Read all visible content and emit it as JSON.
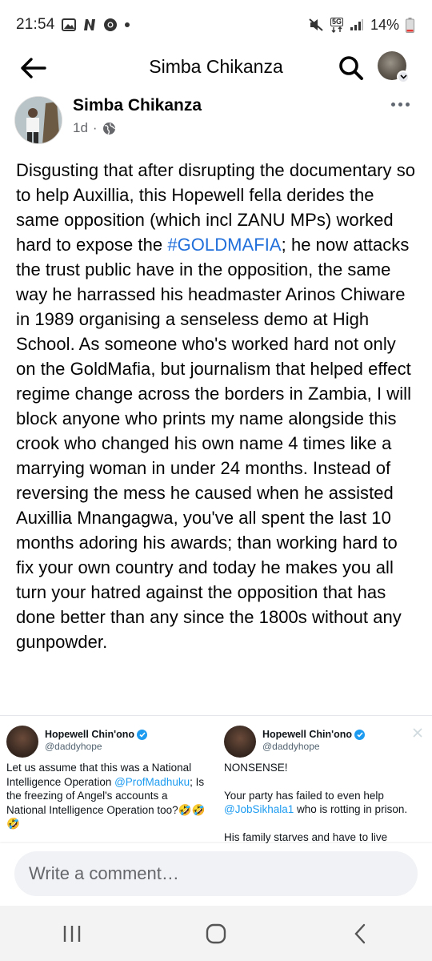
{
  "status_bar": {
    "time": "21:54",
    "network": "5G",
    "battery": "14%"
  },
  "header": {
    "title": "Simba Chikanza"
  },
  "post": {
    "author": "Simba Chikanza",
    "age": "1d",
    "body_before_hashtag": "Disgusting that after disrupting the documentary so to help Auxillia, this Hopewell fella derides the same opposition (which incl ZANU MPs) worked hard to expose the ",
    "hashtag": "#GOLDMAFIA",
    "body_after_hashtag": "; he now attacks the trust public have in the opposition, the same way he harrassed his headmaster Arinos Chiware in 1989 organising a senseless demo at High School. As someone who's worked hard not only on the GoldMafia, but journalism that helped effect regime change across the borders in Zambia, I will block anyone who prints my name alongside this crook who changed his own name 4 times like a marrying woman in under 24 months. Instead of reversing the mess he caused when he assisted Auxillia Mnangagwa, you've all spent the last 10 months adoring his awards; than working hard to fix your own country  and today he makes you all turn your hatred against the opposition that has done better than any since the 1800s without any gunpowder."
  },
  "tweets": [
    {
      "name": "Hopewell Chin'ono",
      "handle": "@daddyhope",
      "text_1": "Let us assume that this was a National Intelligence Operation ",
      "mention_1": "@ProfMadhuku",
      "text_2": "; Is the freezing of Angel's accounts a National Intelligence Operation too?🤣🤣🤣"
    },
    {
      "name": "Hopewell Chin'ono",
      "handle": "@daddyhope",
      "line_1": "NONSENSE!",
      "text_1": "Your party has failed to even help ",
      "mention_1": "@JobSikhala1",
      "text_2": " who is rotting in prison.",
      "line_3": "His family starves and have to live"
    }
  ],
  "comment": {
    "placeholder": "Write a comment…"
  },
  "colors": {
    "link": "#216fdb",
    "twitter_blue": "#1d9bf0",
    "meta_gray": "#65676b",
    "input_bg": "#f0f2f5"
  },
  "icons": [
    "back-arrow-icon",
    "search-icon",
    "profile-avatar",
    "chevron-down-icon",
    "globe-icon",
    "more-icon",
    "verified-icon",
    "x-logo-icon",
    "recent-apps-icon",
    "home-icon",
    "nav-back-icon"
  ]
}
